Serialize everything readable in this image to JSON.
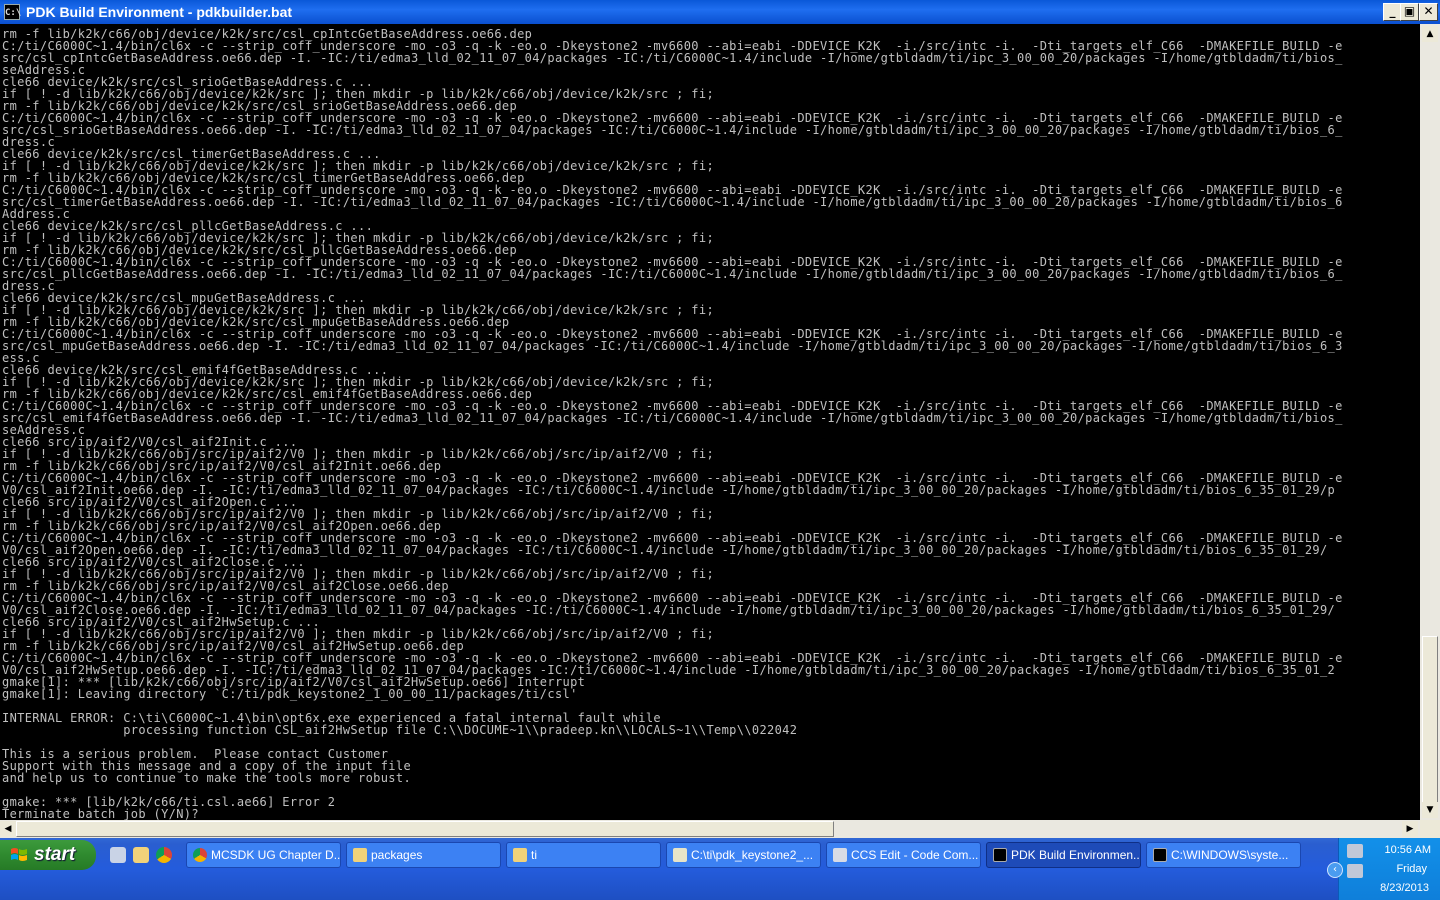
{
  "window": {
    "title": "PDK Build Environment - pdkbuilder.bat",
    "icon": "cmd-icon",
    "controls": {
      "minimize": "_",
      "maximize": "▣",
      "close": "✕"
    }
  },
  "console": {
    "lines": [
      "rm -f lib/k2k/c66/obj/device/k2k/src/csl_cpIntcGetBaseAddress.oe66.dep",
      "C:/ti/C6000C~1.4/bin/cl6x -c --strip_coff_underscore -mo -o3 -q -k -eo.o -Dkeystone2 -mv6600 --abi=eabi -DDEVICE_K2K  -i./src/intc -i.  -Dti_targets_elf_C66  -DMAKEFILE_BUILD -e",
      "src/csl_cpIntcGetBaseAddress.oe66.dep -I. -IC:/ti/edma3_lld_02_11_07_04/packages -IC:/ti/C6000C~1.4/include -I/home/gtbldadm/ti/ipc_3_00_00_20/packages -I/home/gtbldadm/ti/bios_",
      "seAddress.c",
      "cle66 device/k2k/src/csl_srioGetBaseAddress.c ...",
      "if [ ! -d lib/k2k/c66/obj/device/k2k/src ]; then mkdir -p lib/k2k/c66/obj/device/k2k/src ; fi;",
      "rm -f lib/k2k/c66/obj/device/k2k/src/csl_srioGetBaseAddress.oe66.dep",
      "C:/ti/C6000C~1.4/bin/cl6x -c --strip_coff_underscore -mo -o3 -q -k -eo.o -Dkeystone2 -mv6600 --abi=eabi -DDEVICE_K2K  -i./src/intc -i.  -Dti_targets_elf_C66  -DMAKEFILE_BUILD -e",
      "src/csl_srioGetBaseAddress.oe66.dep -I. -IC:/ti/edma3_lld_02_11_07_04/packages -IC:/ti/C6000C~1.4/include -I/home/gtbldadm/ti/ipc_3_00_00_20/packages -I/home/gtbldadm/ti/bios_6_",
      "dress.c",
      "cle66 device/k2k/src/csl_timerGetBaseAddress.c ...",
      "if [ ! -d lib/k2k/c66/obj/device/k2k/src ]; then mkdir -p lib/k2k/c66/obj/device/k2k/src ; fi;",
      "rm -f lib/k2k/c66/obj/device/k2k/src/csl_timerGetBaseAddress.oe66.dep",
      "C:/ti/C6000C~1.4/bin/cl6x -c --strip_coff_underscore -mo -o3 -q -k -eo.o -Dkeystone2 -mv6600 --abi=eabi -DDEVICE_K2K  -i./src/intc -i.  -Dti_targets_elf_C66  -DMAKEFILE_BUILD -e",
      "src/csl_timerGetBaseAddress.oe66.dep -I. -IC:/ti/edma3_lld_02_11_07_04/packages -IC:/ti/C6000C~1.4/include -I/home/gtbldadm/ti/ipc_3_00_00_20/packages -I/home/gtbldadm/ti/bios_6",
      "Address.c",
      "cle66 device/k2k/src/csl_pllcGetBaseAddress.c ...",
      "if [ ! -d lib/k2k/c66/obj/device/k2k/src ]; then mkdir -p lib/k2k/c66/obj/device/k2k/src ; fi;",
      "rm -f lib/k2k/c66/obj/device/k2k/src/csl_pllcGetBaseAddress.oe66.dep",
      "C:/ti/C6000C~1.4/bin/cl6x -c --strip_coff_underscore -mo -o3 -q -k -eo.o -Dkeystone2 -mv6600 --abi=eabi -DDEVICE_K2K  -i./src/intc -i.  -Dti_targets_elf_C66  -DMAKEFILE_BUILD -e",
      "src/csl_pllcGetBaseAddress.oe66.dep -I. -IC:/ti/edma3_lld_02_11_07_04/packages -IC:/ti/C6000C~1.4/include -I/home/gtbldadm/ti/ipc_3_00_00_20/packages -I/home/gtbldadm/ti/bios_6_",
      "dress.c",
      "cle66 device/k2k/src/csl_mpuGetBaseAddress.c ...",
      "if [ ! -d lib/k2k/c66/obj/device/k2k/src ]; then mkdir -p lib/k2k/c66/obj/device/k2k/src ; fi;",
      "rm -f lib/k2k/c66/obj/device/k2k/src/csl_mpuGetBaseAddress.oe66.dep",
      "C:/ti/C6000C~1.4/bin/cl6x -c --strip_coff_underscore -mo -o3 -q -k -eo.o -Dkeystone2 -mv6600 --abi=eabi -DDEVICE_K2K  -i./src/intc -i.  -Dti_targets_elf_C66  -DMAKEFILE_BUILD -e",
      "src/csl_mpuGetBaseAddress.oe66.dep -I. -IC:/ti/edma3_lld_02_11_07_04/packages -IC:/ti/C6000C~1.4/include -I/home/gtbldadm/ti/ipc_3_00_00_20/packages -I/home/gtbldadm/ti/bios_6_3",
      "ess.c",
      "cle66 device/k2k/src/csl_emif4fGetBaseAddress.c ...",
      "if [ ! -d lib/k2k/c66/obj/device/k2k/src ]; then mkdir -p lib/k2k/c66/obj/device/k2k/src ; fi;",
      "rm -f lib/k2k/c66/obj/device/k2k/src/csl_emif4fGetBaseAddress.oe66.dep",
      "C:/ti/C6000C~1.4/bin/cl6x -c --strip_coff_underscore -mo -o3 -q -k -eo.o -Dkeystone2 -mv6600 --abi=eabi -DDEVICE_K2K  -i./src/intc -i.  -Dti_targets_elf_C66  -DMAKEFILE_BUILD -e",
      "src/csl_emif4fGetBaseAddress.oe66.dep -I. -IC:/ti/edma3_lld_02_11_07_04/packages -IC:/ti/C6000C~1.4/include -I/home/gtbldadm/ti/ipc_3_00_00_20/packages -I/home/gtbldadm/ti/bios_",
      "seAddress.c",
      "cle66 src/ip/aif2/V0/csl_aif2Init.c ...",
      "if [ ! -d lib/k2k/c66/obj/src/ip/aif2/V0 ]; then mkdir -p lib/k2k/c66/obj/src/ip/aif2/V0 ; fi;",
      "rm -f lib/k2k/c66/obj/src/ip/aif2/V0/csl_aif2Init.oe66.dep",
      "C:/ti/C6000C~1.4/bin/cl6x -c --strip_coff_underscore -mo -o3 -q -k -eo.o -Dkeystone2 -mv6600 --abi=eabi -DDEVICE_K2K  -i./src/intc -i.  -Dti_targets_elf_C66  -DMAKEFILE_BUILD -e",
      "V0/csl_aif2Init.oe66.dep -I. -IC:/ti/edma3_lld_02_11_07_04/packages -IC:/ti/C6000C~1.4/include -I/home/gtbldadm/ti/ipc_3_00_00_20/packages -I/home/gtbldadm/ti/bios_6_35_01_29/p",
      "cle66 src/ip/aif2/V0/csl_aif2Open.c ...",
      "if [ ! -d lib/k2k/c66/obj/src/ip/aif2/V0 ]; then mkdir -p lib/k2k/c66/obj/src/ip/aif2/V0 ; fi;",
      "rm -f lib/k2k/c66/obj/src/ip/aif2/V0/csl_aif2Open.oe66.dep",
      "C:/ti/C6000C~1.4/bin/cl6x -c --strip_coff_underscore -mo -o3 -q -k -eo.o -Dkeystone2 -mv6600 --abi=eabi -DDEVICE_K2K  -i./src/intc -i.  -Dti_targets_elf_C66  -DMAKEFILE_BUILD -e",
      "V0/csl_aif2Open.oe66.dep -I. -IC:/ti/edma3_lld_02_11_07_04/packages -IC:/ti/C6000C~1.4/include -I/home/gtbldadm/ti/ipc_3_00_00_20/packages -I/home/gtbldadm/ti/bios_6_35_01_29/",
      "cle66 src/ip/aif2/V0/csl_aif2Close.c ...",
      "if [ ! -d lib/k2k/c66/obj/src/ip/aif2/V0 ]; then mkdir -p lib/k2k/c66/obj/src/ip/aif2/V0 ; fi;",
      "rm -f lib/k2k/c66/obj/src/ip/aif2/V0/csl_aif2Close.oe66.dep",
      "C:/ti/C6000C~1.4/bin/cl6x -c --strip_coff_underscore -mo -o3 -q -k -eo.o -Dkeystone2 -mv6600 --abi=eabi -DDEVICE_K2K  -i./src/intc -i.  -Dti_targets_elf_C66  -DMAKEFILE_BUILD -e",
      "V0/csl_aif2Close.oe66.dep -I. -IC:/ti/edma3_lld_02_11_07_04/packages -IC:/ti/C6000C~1.4/include -I/home/gtbldadm/ti/ipc_3_00_00_20/packages -I/home/gtbldadm/ti/bios_6_35_01_29/",
      "cle66 src/ip/aif2/V0/csl_aif2HwSetup.c ...",
      "if [ ! -d lib/k2k/c66/obj/src/ip/aif2/V0 ]; then mkdir -p lib/k2k/c66/obj/src/ip/aif2/V0 ; fi;",
      "rm -f lib/k2k/c66/obj/src/ip/aif2/V0/csl_aif2HwSetup.oe66.dep",
      "C:/ti/C6000C~1.4/bin/cl6x -c --strip_coff_underscore -mo -o3 -q -k -eo.o -Dkeystone2 -mv6600 --abi=eabi -DDEVICE_K2K  -i./src/intc -i.  -Dti_targets_elf_C66  -DMAKEFILE_BUILD -e",
      "V0/csl_aif2HwSetup.oe66.dep -I. -IC:/ti/edma3_lld_02_11_07_04/packages -IC:/ti/C6000C~1.4/include -I/home/gtbldadm/ti/ipc_3_00_00_20/packages -I/home/gtbldadm/ti/bios_6_35_01_2",
      "gmake[1]: *** [lib/k2k/c66/obj/src/ip/aif2/V0/csl_aif2HwSetup.oe66] Interrupt",
      "gmake[1]: Leaving directory `C:/ti/pdk_keystone2_1_00_00_11/packages/ti/csl'",
      "",
      "INTERNAL ERROR: C:\\ti\\C6000C~1.4\\bin\\opt6x.exe experienced a fatal internal fault while",
      "                processing function CSL_aif2HwSetup file C:\\\\DOCUME~1\\\\pradeep.kn\\\\LOCALS~1\\\\Temp\\\\022042",
      "",
      "This is a serious problem.  Please contact Customer",
      "Support with this message and a copy of the input file",
      "and help us to continue to make the tools more robust.",
      "",
      "gmake: *** [lib/k2k/c66/ti.csl.ae66] Error 2",
      "Terminate batch job (Y/N)?"
    ],
    "text_color": "#c0c0c0",
    "background": "#000000"
  },
  "taskbar": {
    "start_label": "start",
    "quick_launch": [
      "cube-icon",
      "folder-icon",
      "chrome-icon"
    ],
    "tasks": [
      {
        "label": "MCSDK UG Chapter D...",
        "icon": "chrome-icon",
        "active": false
      },
      {
        "label": "packages",
        "icon": "folder-icon",
        "active": false
      },
      {
        "label": "ti",
        "icon": "folder-icon",
        "active": false
      },
      {
        "label": "C:\\ti\\pdk_keystone2_...",
        "icon": "notepad-icon",
        "active": false
      },
      {
        "label": "CCS Edit - Code Com...",
        "icon": "ccs-icon",
        "active": false
      },
      {
        "label": "PDK Build Environmen...",
        "icon": "cmd-icon",
        "active": true
      },
      {
        "label": "C:\\WINDOWS\\syste...",
        "icon": "cmd-icon",
        "active": false
      }
    ],
    "clock": {
      "time": "10:56 AM",
      "day": "Friday",
      "date": "8/23/2013"
    }
  }
}
